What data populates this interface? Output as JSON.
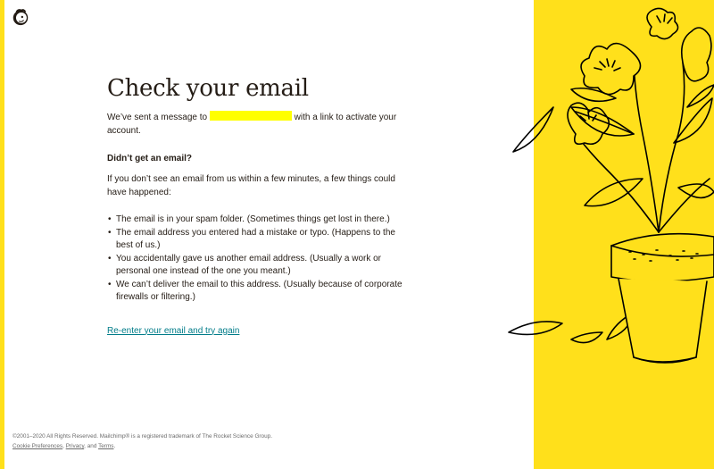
{
  "header": {
    "logo_icon": "mailchimp-freddie-icon"
  },
  "main": {
    "title": "Check your email",
    "sent_prefix": "We’ve sent a message to",
    "sent_suffix": "with a link to activate your account.",
    "subheading": "Didn’t get an email?",
    "intro": "If you don’t see an email from us within a few minutes, a few things could have happened:",
    "reasons": [
      "The email is in your spam folder. (Sometimes things get lost in there.)",
      "The email address you entered had a mistake or typo. (Happens to the best of us.)",
      "You accidentally gave us another email address. (Usually a work or personal one instead of the one you meant.)",
      "We can’t deliver the email to this address. (Usually because of corporate firewalls or filtering.)"
    ],
    "reenter_link": "Re-enter your email and try again"
  },
  "footer": {
    "copyright": "©2001–2020 All Rights Reserved. Mailchimp® is a registered trademark of The Rocket Science Group.",
    "cookie_link": "Cookie Preferences",
    "separator": ",",
    "privacy_link": "Privacy",
    "and_text": ", and",
    "terms_link": "Terms",
    "period": "."
  },
  "colors": {
    "accent_yellow": "#ffe01b",
    "link_teal": "#007c89",
    "redaction": "#ffff00",
    "text": "#241c15"
  },
  "illustration": {
    "icon": "potted-plant-illustration"
  }
}
